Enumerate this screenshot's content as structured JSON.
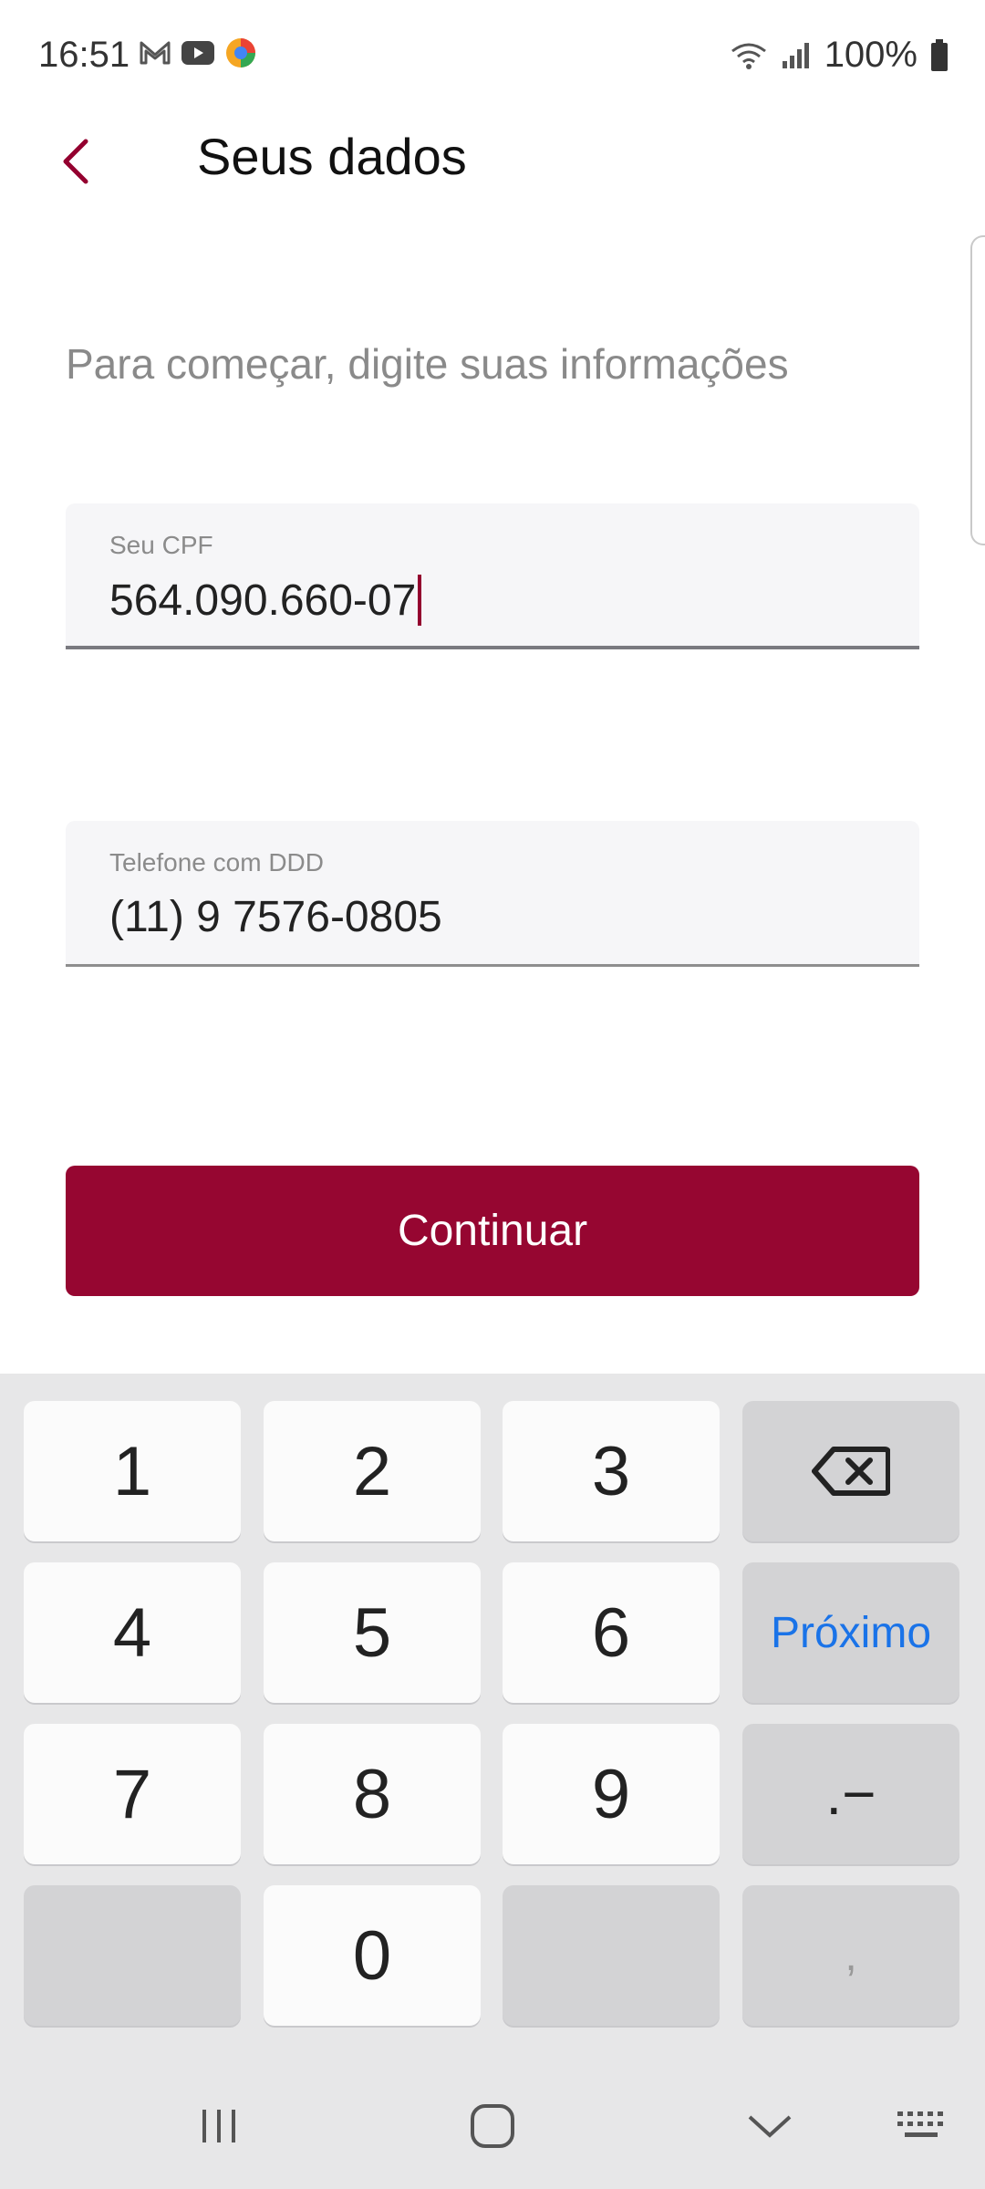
{
  "status_bar": {
    "time": "16:51",
    "battery": "100%",
    "left_icons": [
      "gmail-icon",
      "youtube-icon",
      "app-icon"
    ],
    "right_icons": [
      "wifi-icon",
      "signal-icon",
      "battery-icon"
    ]
  },
  "app_bar": {
    "title": "Seus dados",
    "back_icon": "chevron-left-icon"
  },
  "form": {
    "subtitle": "Para começar, digite suas informações",
    "cpf": {
      "label": "Seu CPF",
      "value": "564.090.660-07"
    },
    "phone": {
      "label": "Telefone com DDD",
      "value": "(11) 9 7576-0805"
    },
    "continue_label": "Continuar"
  },
  "keyboard": {
    "keys": [
      "1",
      "2",
      "3",
      "4",
      "5",
      "6",
      "7",
      "8",
      "9",
      "0"
    ],
    "next_label": "Próximo",
    "punct_label": ".−",
    "comma_label": ",",
    "backspace_icon": "backspace-icon"
  },
  "colors": {
    "accent": "#960631",
    "caret": "#94002f",
    "keyboard_bg": "#e7e7e8",
    "next_key_text": "#1a73e8"
  }
}
